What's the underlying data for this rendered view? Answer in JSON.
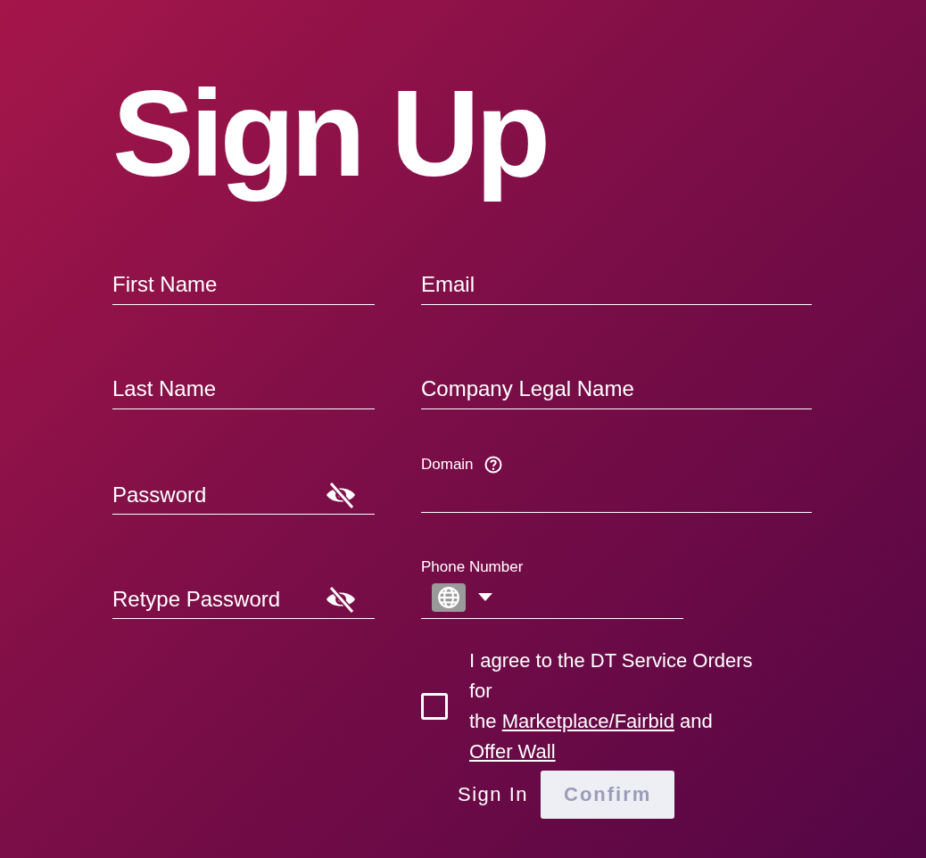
{
  "title": "Sign Up",
  "left_fields": [
    {
      "kind": "text",
      "placeholder": "First Name"
    },
    {
      "kind": "text",
      "placeholder": "Last Name"
    },
    {
      "kind": "password",
      "placeholder": "Password",
      "visible": false
    },
    {
      "kind": "password",
      "placeholder": "Retype Password",
      "visible": false
    }
  ],
  "right_fields": [
    {
      "kind": "text",
      "placeholder": "Email"
    },
    {
      "kind": "text",
      "placeholder": "Company Legal Name"
    },
    {
      "kind": "help",
      "label": "Domain"
    },
    {
      "kind": "phone",
      "label": "Phone Number"
    }
  ],
  "agreement": {
    "checked": false,
    "parts": [
      {
        "kind": "text",
        "text": "I agree to the DT Service Orders for"
      },
      {
        "kind": "break"
      },
      {
        "kind": "text",
        "text": "the "
      },
      {
        "kind": "link",
        "text": "Marketplace/Fairbid"
      },
      {
        "kind": "text",
        "text": " and "
      },
      {
        "kind": "link",
        "text": "Offer Wall"
      }
    ]
  },
  "sign_in": "Sign In",
  "confirm": {
    "label": "Confirm",
    "disabled": true
  }
}
